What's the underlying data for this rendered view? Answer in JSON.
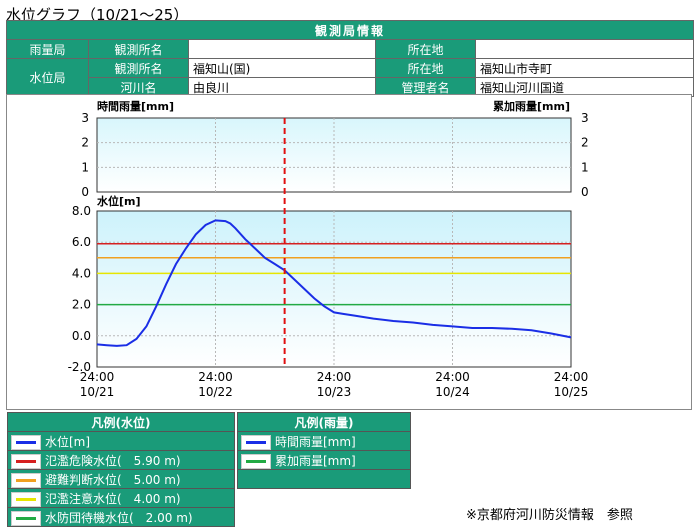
{
  "page_title": "水位グラフ（10/21～25）",
  "info": {
    "header": "観測局情報",
    "rainfall_station": {
      "label": "雨量局",
      "name_label": "観測所名",
      "name_value": "",
      "location_label": "所在地",
      "location_value": ""
    },
    "water_station": {
      "label": "水位局",
      "name_label": "観測所名",
      "name_value": "福知山(国)",
      "location_label": "所在地",
      "location_value": "福知山市寺町",
      "river_label": "河川名",
      "river_value": "由良川",
      "manager_label": "管理者名",
      "manager_value": "福知山河川国道"
    }
  },
  "chart_data": [
    {
      "type": "bar",
      "title": "",
      "ylabel": "時間雨量[mm]",
      "ylabel_right": "累加雨量[mm]",
      "ylim": [
        0,
        3
      ],
      "yticks": [
        0,
        1,
        2,
        3
      ],
      "yticks_right": [
        0,
        1,
        2,
        3
      ],
      "values": [],
      "grid": true
    },
    {
      "type": "line",
      "title": "",
      "ylabel": "水位[m]",
      "ylim": [
        -2.0,
        8.0
      ],
      "yticks": [
        "-2.0",
        "0.0",
        "2.0",
        "4.0",
        "6.0",
        "8.0"
      ],
      "xlim": [
        0,
        96
      ],
      "xticks": [
        {
          "time": "24:00",
          "date": "10/21",
          "h": 0
        },
        {
          "time": "24:00",
          "date": "10/22",
          "h": 24
        },
        {
          "time": "24:00",
          "date": "10/23",
          "h": 48
        },
        {
          "time": "24:00",
          "date": "10/24",
          "h": 72
        },
        {
          "time": "24:00",
          "date": "10/25",
          "h": 96
        }
      ],
      "current_time_h": 38,
      "reference_lines": [
        {
          "name": "氾濫危険水位",
          "value": 5.9,
          "color": "#d62020"
        },
        {
          "name": "避難判断水位",
          "value": 5.0,
          "color": "#f0a020"
        },
        {
          "name": "氾濫注意水位",
          "value": 4.0,
          "color": "#e6e600"
        },
        {
          "name": "水防団待機水位",
          "value": 2.0,
          "color": "#22aa44"
        }
      ],
      "series": [
        {
          "name": "水位[m]",
          "color": "#1a2ee6",
          "x": [
            0,
            2,
            4,
            6,
            8,
            10,
            12,
            14,
            16,
            18,
            20,
            22,
            24,
            26,
            27,
            28,
            30,
            32,
            34,
            36,
            38,
            40,
            42,
            44,
            46,
            48,
            50,
            52,
            56,
            60,
            64,
            68,
            72,
            76,
            80,
            84,
            88,
            92,
            96
          ],
          "y": [
            -0.55,
            -0.6,
            -0.65,
            -0.6,
            -0.2,
            0.6,
            1.9,
            3.3,
            4.6,
            5.6,
            6.5,
            7.1,
            7.4,
            7.35,
            7.2,
            6.9,
            6.2,
            5.6,
            5.0,
            4.6,
            4.2,
            3.6,
            3.0,
            2.4,
            1.9,
            1.5,
            1.4,
            1.3,
            1.1,
            0.95,
            0.85,
            0.7,
            0.6,
            0.5,
            0.5,
            0.45,
            0.35,
            0.15,
            -0.1
          ]
        }
      ]
    }
  ],
  "legend_water": {
    "header": "凡例(水位)",
    "items": [
      {
        "label": "水位[m]",
        "color": "#1a2ee6"
      },
      {
        "label": "氾濫危険水位(　5.90 m)",
        "color": "#d62020"
      },
      {
        "label": "避難判断水位(　5.00 m)",
        "color": "#f0a020"
      },
      {
        "label": "氾濫注意水位(　4.00 m)",
        "color": "#e6e600"
      },
      {
        "label": "水防団待機水位(　2.00 m)",
        "color": "#22aa44"
      }
    ]
  },
  "legend_rain": {
    "header": "凡例(雨量)",
    "items": [
      {
        "label": "時間雨量[mm]",
        "color": "#1a2ee6"
      },
      {
        "label": "累加雨量[mm]",
        "color": "#22aa44"
      }
    ]
  },
  "source_note": "※京都府河川防災情報　参照"
}
